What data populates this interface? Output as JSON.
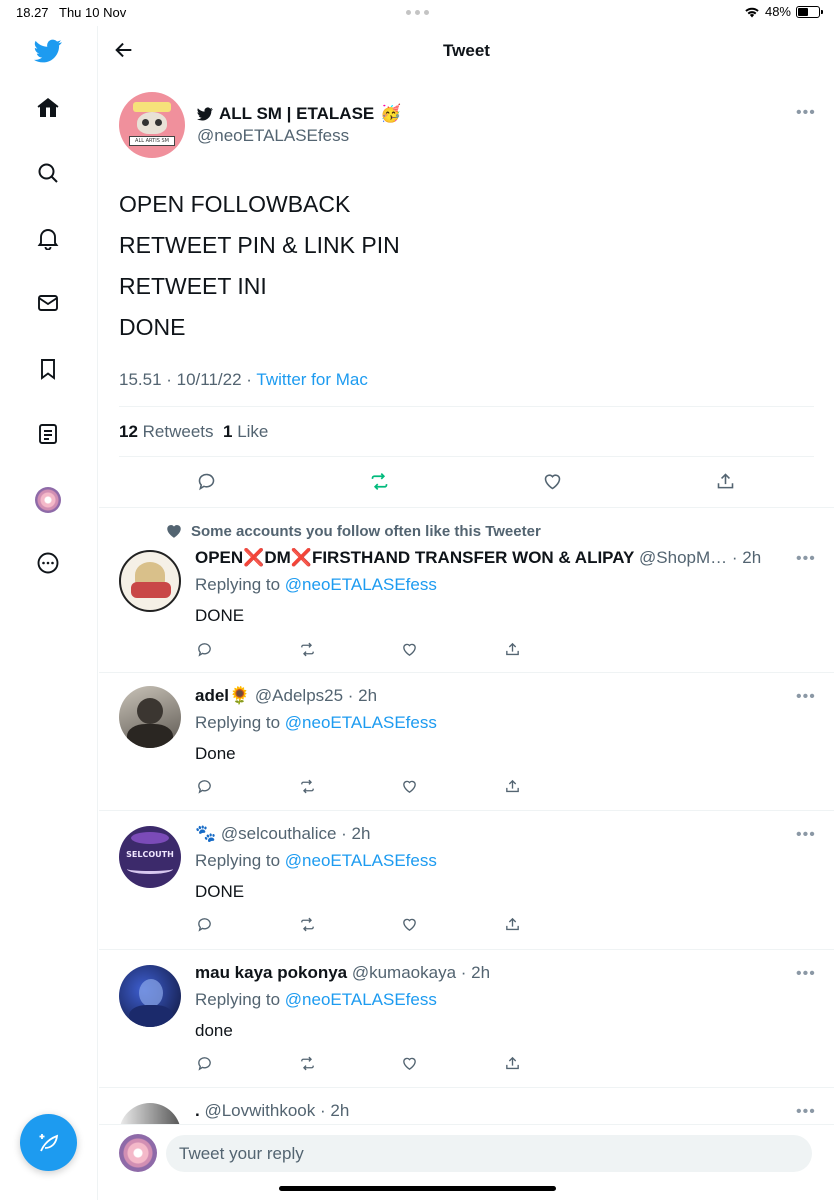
{
  "status_bar": {
    "time": "18.27",
    "date": "Thu 10 Nov",
    "battery": "48%",
    "battery_level": 0.48
  },
  "header": {
    "title": "Tweet"
  },
  "sidebar": {
    "items": [
      "twitter-logo",
      "home",
      "search",
      "notifications",
      "messages",
      "bookmarks",
      "lists",
      "profile",
      "more"
    ]
  },
  "tweet": {
    "author_name": "ALL SM | ETALASE",
    "author_emoji": "🥳",
    "author_handle": "@neoETALASEfess",
    "avatar_text": "ALL ARTIS SM",
    "lines": [
      "OPEN FOLLOWBACK",
      "RETWEET PIN & LINK PIN",
      "RETWEET INI",
      "DONE"
    ],
    "time": "15.51 · 10/11/22 · ",
    "source": "Twitter for Mac",
    "retweets": "12",
    "retweets_label": "Retweets",
    "likes": "1",
    "likes_label": "Like"
  },
  "social_context": "Some accounts you follow often like this Tweeter",
  "replies": [
    {
      "name": "OPEN❌DM❌FIRSTHAND TRANSFER WON & ALIPAY",
      "handle_time": " @ShopM… · 2h",
      "replying_prefix": "Replying to ",
      "replying_to": "@neoETALASEfess",
      "text": "DONE"
    },
    {
      "name": "adel🌻",
      "handle_time": " @Adelps25 · 2h",
      "replying_prefix": "Replying to ",
      "replying_to": "@neoETALASEfess",
      "text": "Done"
    },
    {
      "name": "🐾",
      "handle_time": " @selcouthalice · 2h",
      "replying_prefix": "Replying to ",
      "replying_to": "@neoETALASEfess",
      "text": "DONE",
      "avatar_text": "SELCOUTH"
    },
    {
      "name": "mau kaya pokonya",
      "handle_time": " @kumaokaya · 2h",
      "replying_prefix": "Replying to ",
      "replying_to": "@neoETALASEfess",
      "text": "done"
    },
    {
      "name": ".",
      "handle_time": " @Lovwithkook · 2h"
    }
  ],
  "reply_bar": {
    "placeholder": "Tweet your reply"
  },
  "colors": {
    "accent": "#1d9bf0",
    "retweet_green": "#00ba7c",
    "secondary_text": "#536471"
  }
}
